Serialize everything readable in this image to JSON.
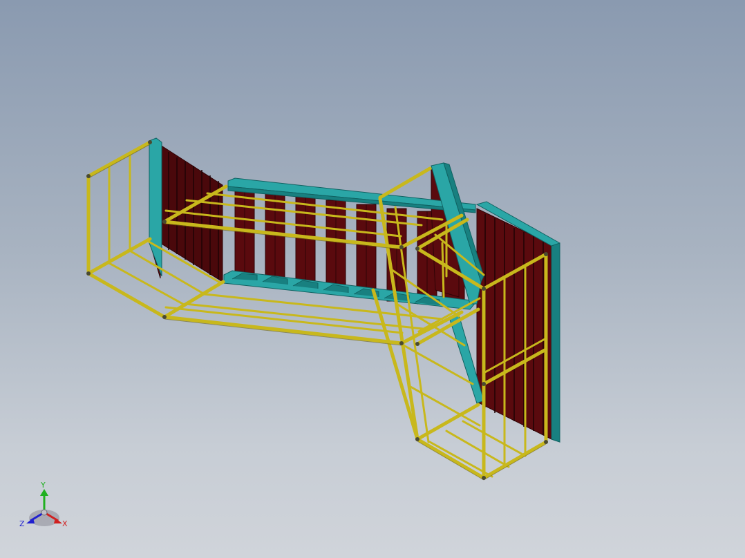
{
  "viewport": {
    "background_top": "#8a9ab0",
    "background_bottom": "#d0d4da"
  },
  "model": {
    "frame_color": "#c8b81c",
    "frame_dark": "#6e6410",
    "channel_color": "#2aa6a6",
    "channel_dark": "#106262",
    "panel_color": "#5a0a0e",
    "panel_dark": "#2e0406"
  },
  "triad": {
    "x_label": "X",
    "y_label": "Y",
    "z_label": "Z",
    "x_color": "#d02020",
    "y_color": "#20b020",
    "z_color": "#2020d0"
  }
}
